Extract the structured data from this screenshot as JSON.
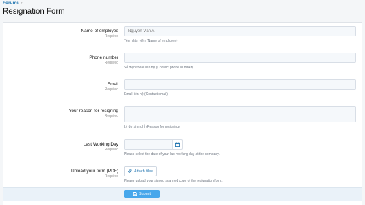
{
  "breadcrumb": {
    "items": [
      "Forums"
    ],
    "separator": "›"
  },
  "page": {
    "title": "Resignation Form"
  },
  "fields": {
    "name": {
      "label": "Name of employee",
      "required": "Required",
      "placeholder": "Nguyễn Văn A",
      "hint": "Tên nhân viên (Name of employee)"
    },
    "phone": {
      "label": "Phone number",
      "required": "Required",
      "placeholder": "",
      "hint": "Số điện thoại liên hệ (Contact phone number)"
    },
    "email": {
      "label": "Email",
      "required": "Required",
      "placeholder": "",
      "hint": "Email liên hệ (Contact email)"
    },
    "reason": {
      "label": "Your reason for resigning",
      "required": "Required",
      "placeholder": "",
      "hint": "Lý do xin nghỉ (Reason for resigning)"
    },
    "last_day": {
      "label": "Last Working Day",
      "required": "Required",
      "hint": "Please select the date of your last working day at the company."
    },
    "upload": {
      "label": "Upload your form (PDF)",
      "required": "Required",
      "button_label": "Attach files",
      "hint": "Please upload your signed scanned copy of the resignation form."
    }
  },
  "actions": {
    "submit_label": "Submit"
  },
  "icons": {
    "calendar": "calendar-icon",
    "paperclip": "paperclip-icon",
    "save": "save-icon"
  },
  "colors": {
    "accent": "#47a7eb",
    "link": "#2577b1"
  }
}
